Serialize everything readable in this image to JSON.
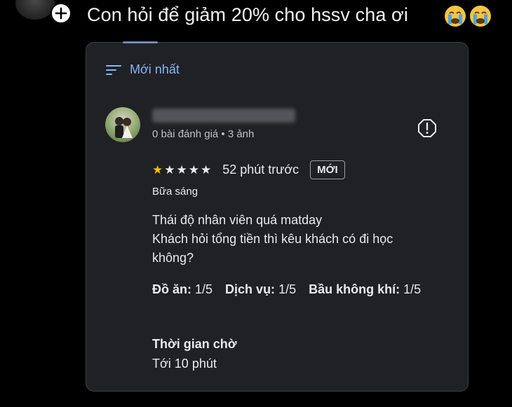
{
  "post": {
    "text": "Con hỏi để giảm 20% cho hssv cha ơi",
    "emojis": [
      "😭",
      "😭"
    ]
  },
  "sort": {
    "label": "Mới nhất",
    "icon": "sort-icon"
  },
  "reviewer": {
    "meta": "0 bài đánh giá • 3 ảnh"
  },
  "review": {
    "rating": 1,
    "max_rating": 5,
    "time_ago": "52 phút trước",
    "badge": "MỚI",
    "meal": "Bữa sáng",
    "lines": [
      "Thái độ nhân viên quá matday",
      "Khách hỏi tổng tiền thì kêu khách có đi học",
      "không?"
    ],
    "sub_ratings": [
      {
        "label": "Đồ ăn:",
        "value": "1/5"
      },
      {
        "label": "Dịch vụ:",
        "value": "1/5"
      },
      {
        "label": "Bầu không khí:",
        "value": "1/5"
      }
    ],
    "wait_label": "Thời gian chờ",
    "wait_value": "Tới 10 phút"
  },
  "colors": {
    "accent": "#8ab4f8",
    "star": "#fbbc04",
    "card_bg": "#202124",
    "page_bg": "#000000"
  }
}
